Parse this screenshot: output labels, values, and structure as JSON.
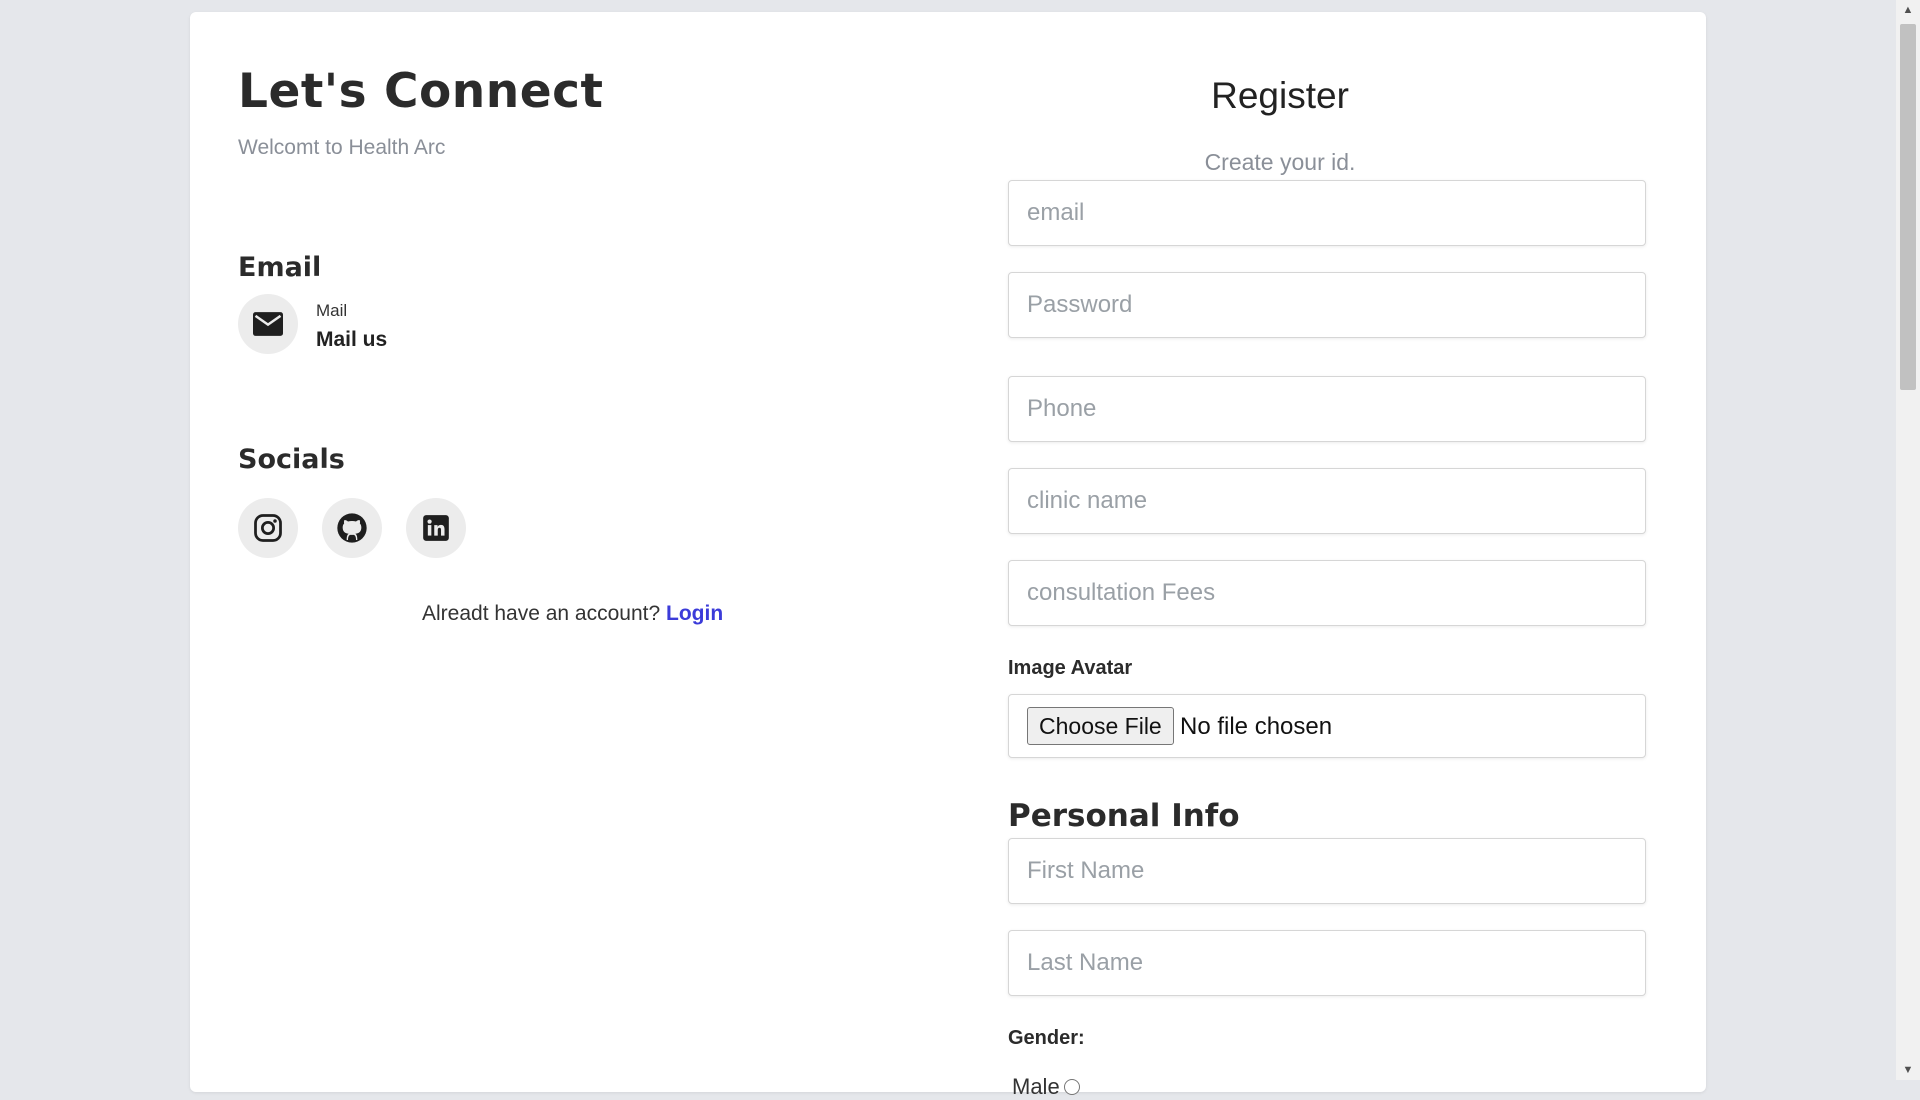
{
  "left": {
    "title": "Let's Connect",
    "subtitle": "Welcomt to Health Arc",
    "email_heading": "Email",
    "mail_label": "Mail",
    "mail_link": "Mail us",
    "socials_heading": "Socials",
    "socials": [
      "instagram-icon",
      "github-icon",
      "linkedin-icon"
    ],
    "login_prompt": "Alreadt have an account?",
    "login_link": "Login"
  },
  "form": {
    "title": "Register",
    "subtitle": "Create your id.",
    "email_placeholder": "email",
    "password_placeholder": "Password",
    "phone_placeholder": "Phone",
    "clinic_placeholder": "clinic name",
    "fees_placeholder": "consultation Fees",
    "avatar_label": "Image Avatar",
    "file_button": "Choose File",
    "file_status": "No file chosen",
    "personal_heading": "Personal Info",
    "first_name_placeholder": "First Name",
    "last_name_placeholder": "Last Name",
    "gender_label": "Gender:",
    "gender_option_male": "Male"
  },
  "colors": {
    "page_bg": "#e5e7eb",
    "card_bg": "#ffffff",
    "link": "#3b3bd9",
    "muted_text": "#8a8f98"
  }
}
